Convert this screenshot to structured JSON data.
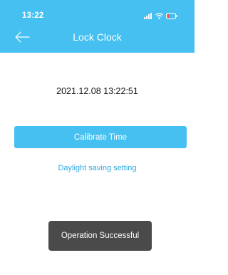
{
  "status_bar": {
    "time": "13:22",
    "icons": [
      "signal-icon",
      "wifi-icon",
      "battery-icon"
    ]
  },
  "header": {
    "back_icon": "back-arrow-icon",
    "title": "Lock Clock"
  },
  "main": {
    "datetime": "2021.12.08 13:22:51",
    "calibrate_label": "Calibrate Time",
    "dst_link_label": "Daylight saving setting"
  },
  "toast": {
    "message": "Operation Successful"
  },
  "colors": {
    "header": "#45c0f0",
    "button": "#45c0f0",
    "link": "#2fa9e2",
    "toast": "#4a4a4a"
  }
}
